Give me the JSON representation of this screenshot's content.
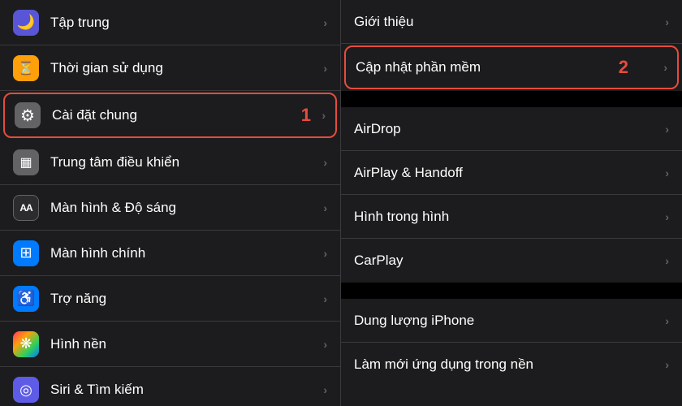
{
  "left_panel": {
    "items": [
      {
        "id": "tap-trung",
        "label": "Tập trung",
        "icon": "🌙",
        "icon_bg": "icon-purple",
        "highlighted": false
      },
      {
        "id": "thoi-gian-su-dung",
        "label": "Thời gian sử dụng",
        "icon": "⏱",
        "icon_bg": "icon-yellow",
        "highlighted": false
      },
      {
        "id": "cai-dat-chung",
        "label": "Cài đặt chung",
        "icon": "⚙️",
        "icon_bg": "icon-gray",
        "highlighted": true
      },
      {
        "id": "trung-tam-dieu-khien",
        "label": "Trung tâm điều khiển",
        "icon": "▦",
        "icon_bg": "icon-gray",
        "highlighted": false
      },
      {
        "id": "man-hinh-do-sang",
        "label": "Màn hình & Độ sáng",
        "icon": "AA",
        "icon_bg": "icon-dark",
        "highlighted": false
      },
      {
        "id": "man-hinh-chinh",
        "label": "Màn hình chính",
        "icon": "⊞",
        "icon_bg": "icon-blue",
        "highlighted": false
      },
      {
        "id": "tro-nang",
        "label": "Trợ năng",
        "icon": "♿",
        "icon_bg": "icon-blue",
        "highlighted": false
      },
      {
        "id": "hinh-nen",
        "label": "Hình nền",
        "icon": "✦",
        "icon_bg": "icon-multi",
        "highlighted": false
      },
      {
        "id": "siri-tim-kiem",
        "label": "Siri & Tìm kiếm",
        "icon": "◎",
        "icon_bg": "icon-indigo",
        "highlighted": false
      }
    ],
    "badge_number": "1"
  },
  "right_panel": {
    "groups": [
      {
        "items": [
          {
            "id": "gioi-thieu",
            "label": "Giới thiệu",
            "highlighted": false
          },
          {
            "id": "cap-nhat-phan-mem",
            "label": "Cập nhật phần mềm",
            "highlighted": true
          }
        ]
      },
      {
        "items": [
          {
            "id": "airdrop",
            "label": "AirDrop",
            "highlighted": false
          },
          {
            "id": "airplay-handoff",
            "label": "AirPlay & Handoff",
            "highlighted": false
          },
          {
            "id": "hinh-trong-hinh",
            "label": "Hình trong hình",
            "highlighted": false
          },
          {
            "id": "carplay",
            "label": "CarPlay",
            "highlighted": false
          }
        ]
      },
      {
        "items": [
          {
            "id": "dung-luong-iphone",
            "label": "Dung lượng iPhone",
            "highlighted": false
          },
          {
            "id": "lam-moi-ung-dung",
            "label": "Làm mới ứng dụng trong nền",
            "highlighted": false
          }
        ]
      }
    ],
    "badge_number": "2"
  },
  "icons": {
    "moon": "🌙",
    "hourglass": "⏳",
    "gear": "⚙",
    "sliders": "☰",
    "aa": "AA",
    "grid": "⊞",
    "accessibility": "⊙",
    "wallpaper": "❋",
    "siri": "◎",
    "chevron": "›"
  }
}
